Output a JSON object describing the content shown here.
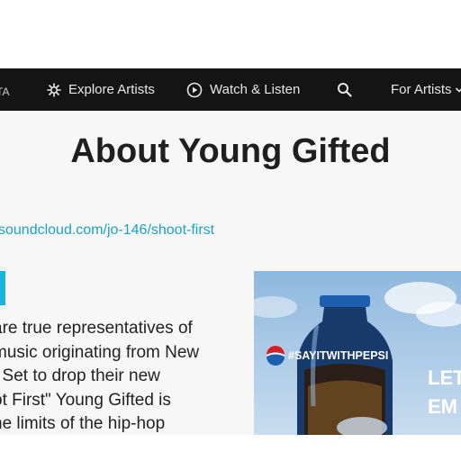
{
  "nav": {
    "cut_label": "TA",
    "explore_label": "Explore Artists",
    "watch_label": "Watch & Listen",
    "for_artists_label": "For Artists",
    "icons": [
      "star-burst-icon",
      "play-circle-icon",
      "search-icon",
      "chevron-down-icon"
    ]
  },
  "page": {
    "title": "About Young Gifted",
    "link": "soundcloud.com/jo-146/shoot-first",
    "bio_lines": [
      "are true representatives of",
      "music originating from New",
      ". Set to drop their new",
      "ot First\" Young Gifted is",
      "he limits of the hip-hop"
    ]
  },
  "ad": {
    "hashtag": "#SAYITWITHPEPSI",
    "side_text_line1": "LET",
    "side_text_line2": "EM"
  },
  "colors": {
    "nav_bg": "#141414",
    "link": "#1aa3c7",
    "accent": "#19b4e2",
    "ad_sky": "#a9c9e6"
  }
}
